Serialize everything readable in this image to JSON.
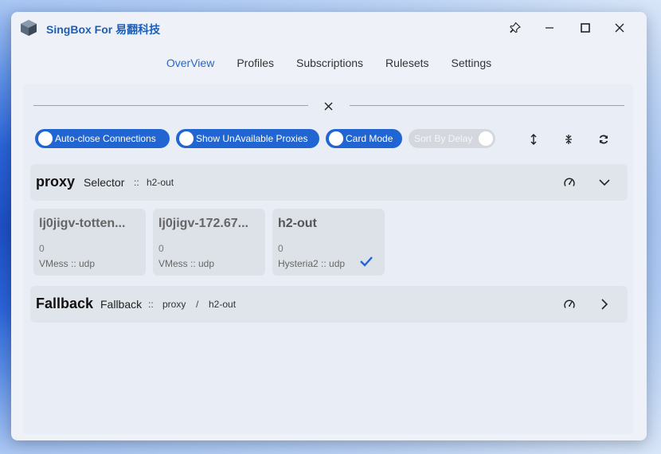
{
  "window": {
    "title": "SingBox For 易翻科技"
  },
  "nav": {
    "tabs": [
      "OverView",
      "Profiles",
      "Subscriptions",
      "Rulesets",
      "Settings"
    ],
    "active": "OverView"
  },
  "toolbar": {
    "auto_close": "Auto-close Connections",
    "show_unavailable": "Show UnAvailable Proxies",
    "card_mode": "Card Mode",
    "sort_by_delay": "Sort By Delay"
  },
  "groups": [
    {
      "name": "proxy",
      "type": "Selector",
      "sep": "::",
      "now": "h2-out",
      "expanded": true,
      "proxies": [
        {
          "name": "lj0jigv-totten...",
          "delay": "0",
          "type": "VMess :: udp",
          "selected": false
        },
        {
          "name": "lj0jigv-172.67...",
          "delay": "0",
          "type": "VMess :: udp",
          "selected": false
        },
        {
          "name": "h2-out",
          "delay": "0",
          "type": "Hysteria2 :: udp",
          "selected": true
        }
      ]
    },
    {
      "name": "Fallback",
      "type": "Fallback",
      "sep": "::",
      "path_1": "proxy",
      "path_sep": "/",
      "path_2": "h2-out",
      "expanded": false
    }
  ],
  "colors": {
    "accent": "#2065d1",
    "title": "#1d5fb8"
  }
}
